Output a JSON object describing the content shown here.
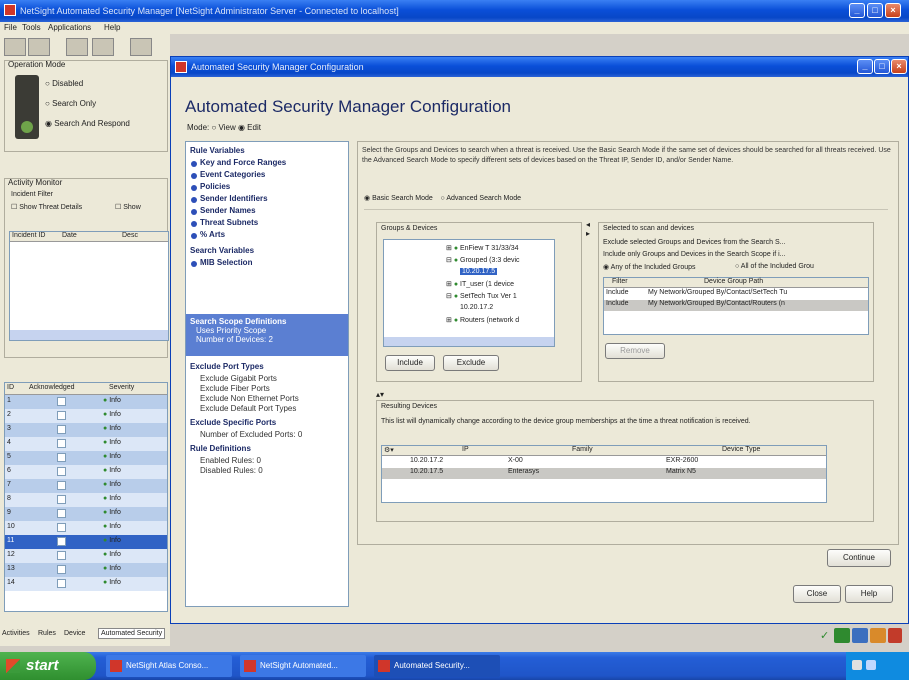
{
  "main_window": {
    "title": "NetSight Automated Security Manager [NetSight Administrator Server - Connected to localhost]"
  },
  "menu": [
    "File",
    "Tools",
    "Applications",
    "Help"
  ],
  "left": {
    "operation_mode_label": "Operation Mode",
    "modes": [
      "Disabled",
      "Search Only",
      "Search And Respond"
    ],
    "activity_monitor_label": "Activity Monitor",
    "incident_filter_label": "Incident Filter",
    "show_threat_details": "Show Threat Details",
    "show_label": "Show",
    "list_headers": [
      "Incident ID",
      "Date",
      "Desc"
    ],
    "table_headers": [
      "ID",
      "Acknowledged",
      "Severity"
    ],
    "rows": [
      "1",
      "2",
      "3",
      "4",
      "5",
      "6",
      "7",
      "8",
      "9",
      "10",
      "11",
      "12",
      "13",
      "14"
    ],
    "severity": "Info",
    "tabs": [
      "Activities",
      "Rules",
      "Device"
    ],
    "tab_active": "Automated Security"
  },
  "dialog": {
    "title": "Automated Security Manager Configuration",
    "heading": "Automated Security Manager Configuration",
    "mode_label": "Mode:",
    "mode_view": "View",
    "mode_edit": "Edit",
    "nav": {
      "rule_variables": "Rule Variables",
      "rv_items": [
        "Key and Force Ranges",
        "Event Categories",
        "Policies",
        "Sender Identifiers",
        "Sender Names",
        "Threat Subnets",
        "% Arts"
      ],
      "search_variables": "Search Variables",
      "sv_items": [
        "MIB Selection"
      ],
      "search_scope": "Search Scope Definitions",
      "scope_sub": [
        "Uses Priority Scope",
        "Number of Devices: 2"
      ],
      "exclude_port_types": "Exclude Port Types",
      "ept_items": [
        "Exclude Gigabit Ports",
        "Exclude Fiber Ports",
        "Exclude Non Ethernet Ports",
        "Exclude Default Port Types"
      ],
      "exclude_specific_ports": "Exclude Specific Ports",
      "esp_items": [
        "Number of Excluded Ports: 0"
      ],
      "rule_definitions": "Rule Definitions",
      "rd_items": [
        "Enabled Rules: 0",
        "Disabled Rules: 0"
      ]
    },
    "description": "Select the Groups and Devices to search when a threat is received. Use the Basic Search Mode if the same set of devices should be searched for all threats received. Use the Advanced Search Mode to specify different sets of devices based on the Threat IP, Sender ID, and/or Sender Name.",
    "search_basic": "Basic Search Mode",
    "search_advanced": "Advanced Search Mode",
    "groups_label": "Groups & Devices",
    "tree": [
      "EnFiew T 31/33/34",
      "Grouped (3:3 devic",
      "10.20.17.5",
      "IT_user (1 device",
      "SetTech Tux Ver 1",
      "10.20.17.2",
      "Routers (network d"
    ],
    "include_btn": "Include",
    "exclude_btn": "Exclude",
    "selected_label": "Selected to scan and devices",
    "selected_desc1": "Exclude selected Groups and Devices from the Search S...",
    "selected_desc2": "Include only Groups and Devices in the Search Scope if i...",
    "any_excluded": "Any of the Included Groups",
    "all_excluded": "All of the Included Grou",
    "sel_headers": [
      "Filter",
      "Device Group Path"
    ],
    "sel_rows": [
      [
        "Include",
        "My Network/Grouped By/Contact/SetTech Tu"
      ],
      [
        "Include",
        "My Network/Grouped By/Contact/Routers (n"
      ]
    ],
    "remove_btn": "Remove",
    "resulting_label": "Resulting Devices",
    "resulting_desc": "This list will dynamically change according to the device group memberships at the time a threat notification is received.",
    "res_headers": [
      "IP",
      "Family",
      "Device Type"
    ],
    "res_rows": [
      [
        "10.20.17.2",
        "X-00",
        "EXR-2600"
      ],
      [
        "10.20.17.5",
        "Enterasys",
        "Matrix N5"
      ]
    ],
    "continue_btn": "Continue",
    "close_btn": "Close",
    "help_btn": "Help"
  },
  "taskbar": {
    "start": "start",
    "items": [
      "NetSight Atlas Conso...",
      "NetSight Automated...",
      "Automated Security..."
    ]
  }
}
